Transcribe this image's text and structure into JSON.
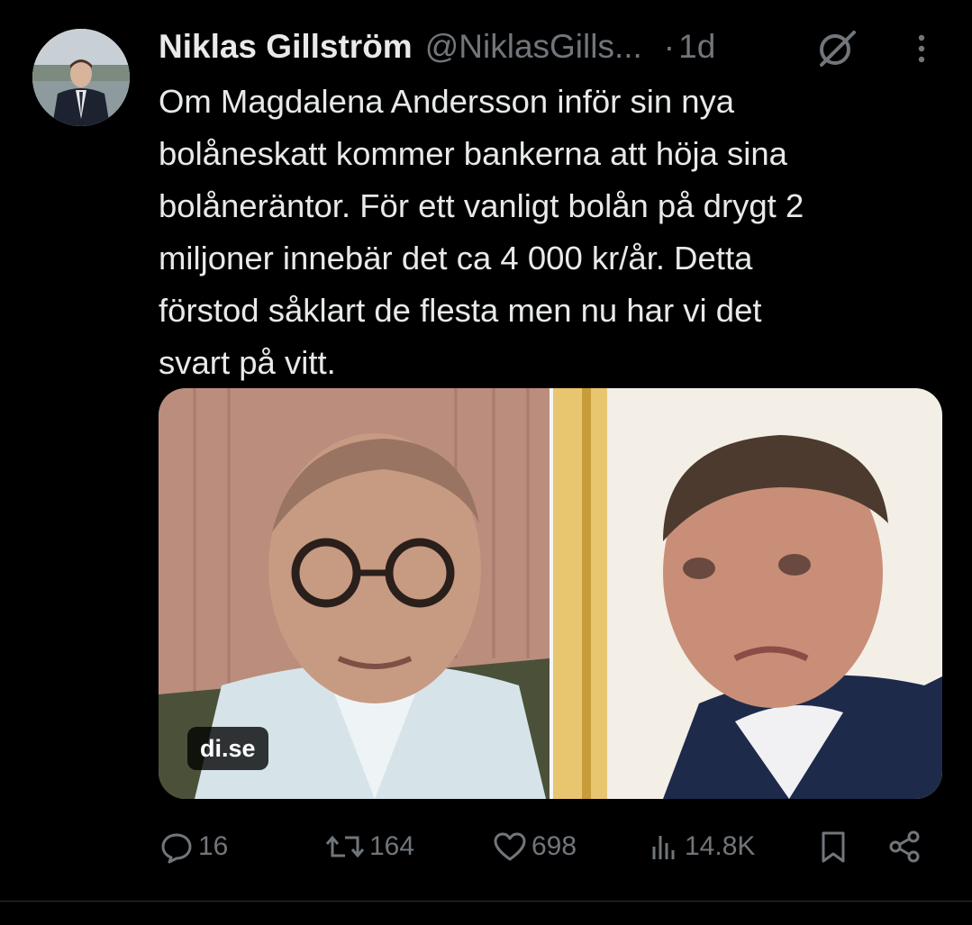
{
  "author": {
    "name": "Niklas Gillström",
    "handle": "@NiklasGills...",
    "separator": "·",
    "time": "1d"
  },
  "tweet": {
    "text": "Om Magdalena Andersson inför sin nya\nbolåneskatt kommer bankerna att höja sina\nbolåneräntor. För ett vanligt bolån på drygt 2\nmiljoner innebär det ca 4 000 kr/år. Detta\nförstod såklart de flesta men nu har vi det\nsvart på vitt."
  },
  "media": {
    "source_badge": "di.se"
  },
  "actions": {
    "replies": "16",
    "reposts": "164",
    "likes": "698",
    "views": "14.8K"
  },
  "icons": {
    "grok": "grok-icon",
    "more": "more-icon",
    "reply": "reply-icon",
    "repost": "repost-icon",
    "like": "heart-icon",
    "views": "views-icon",
    "bookmark": "bookmark-icon",
    "share": "share-icon"
  },
  "colors": {
    "background": "#000000",
    "text": "#e7e9ea",
    "muted": "#71767b"
  }
}
